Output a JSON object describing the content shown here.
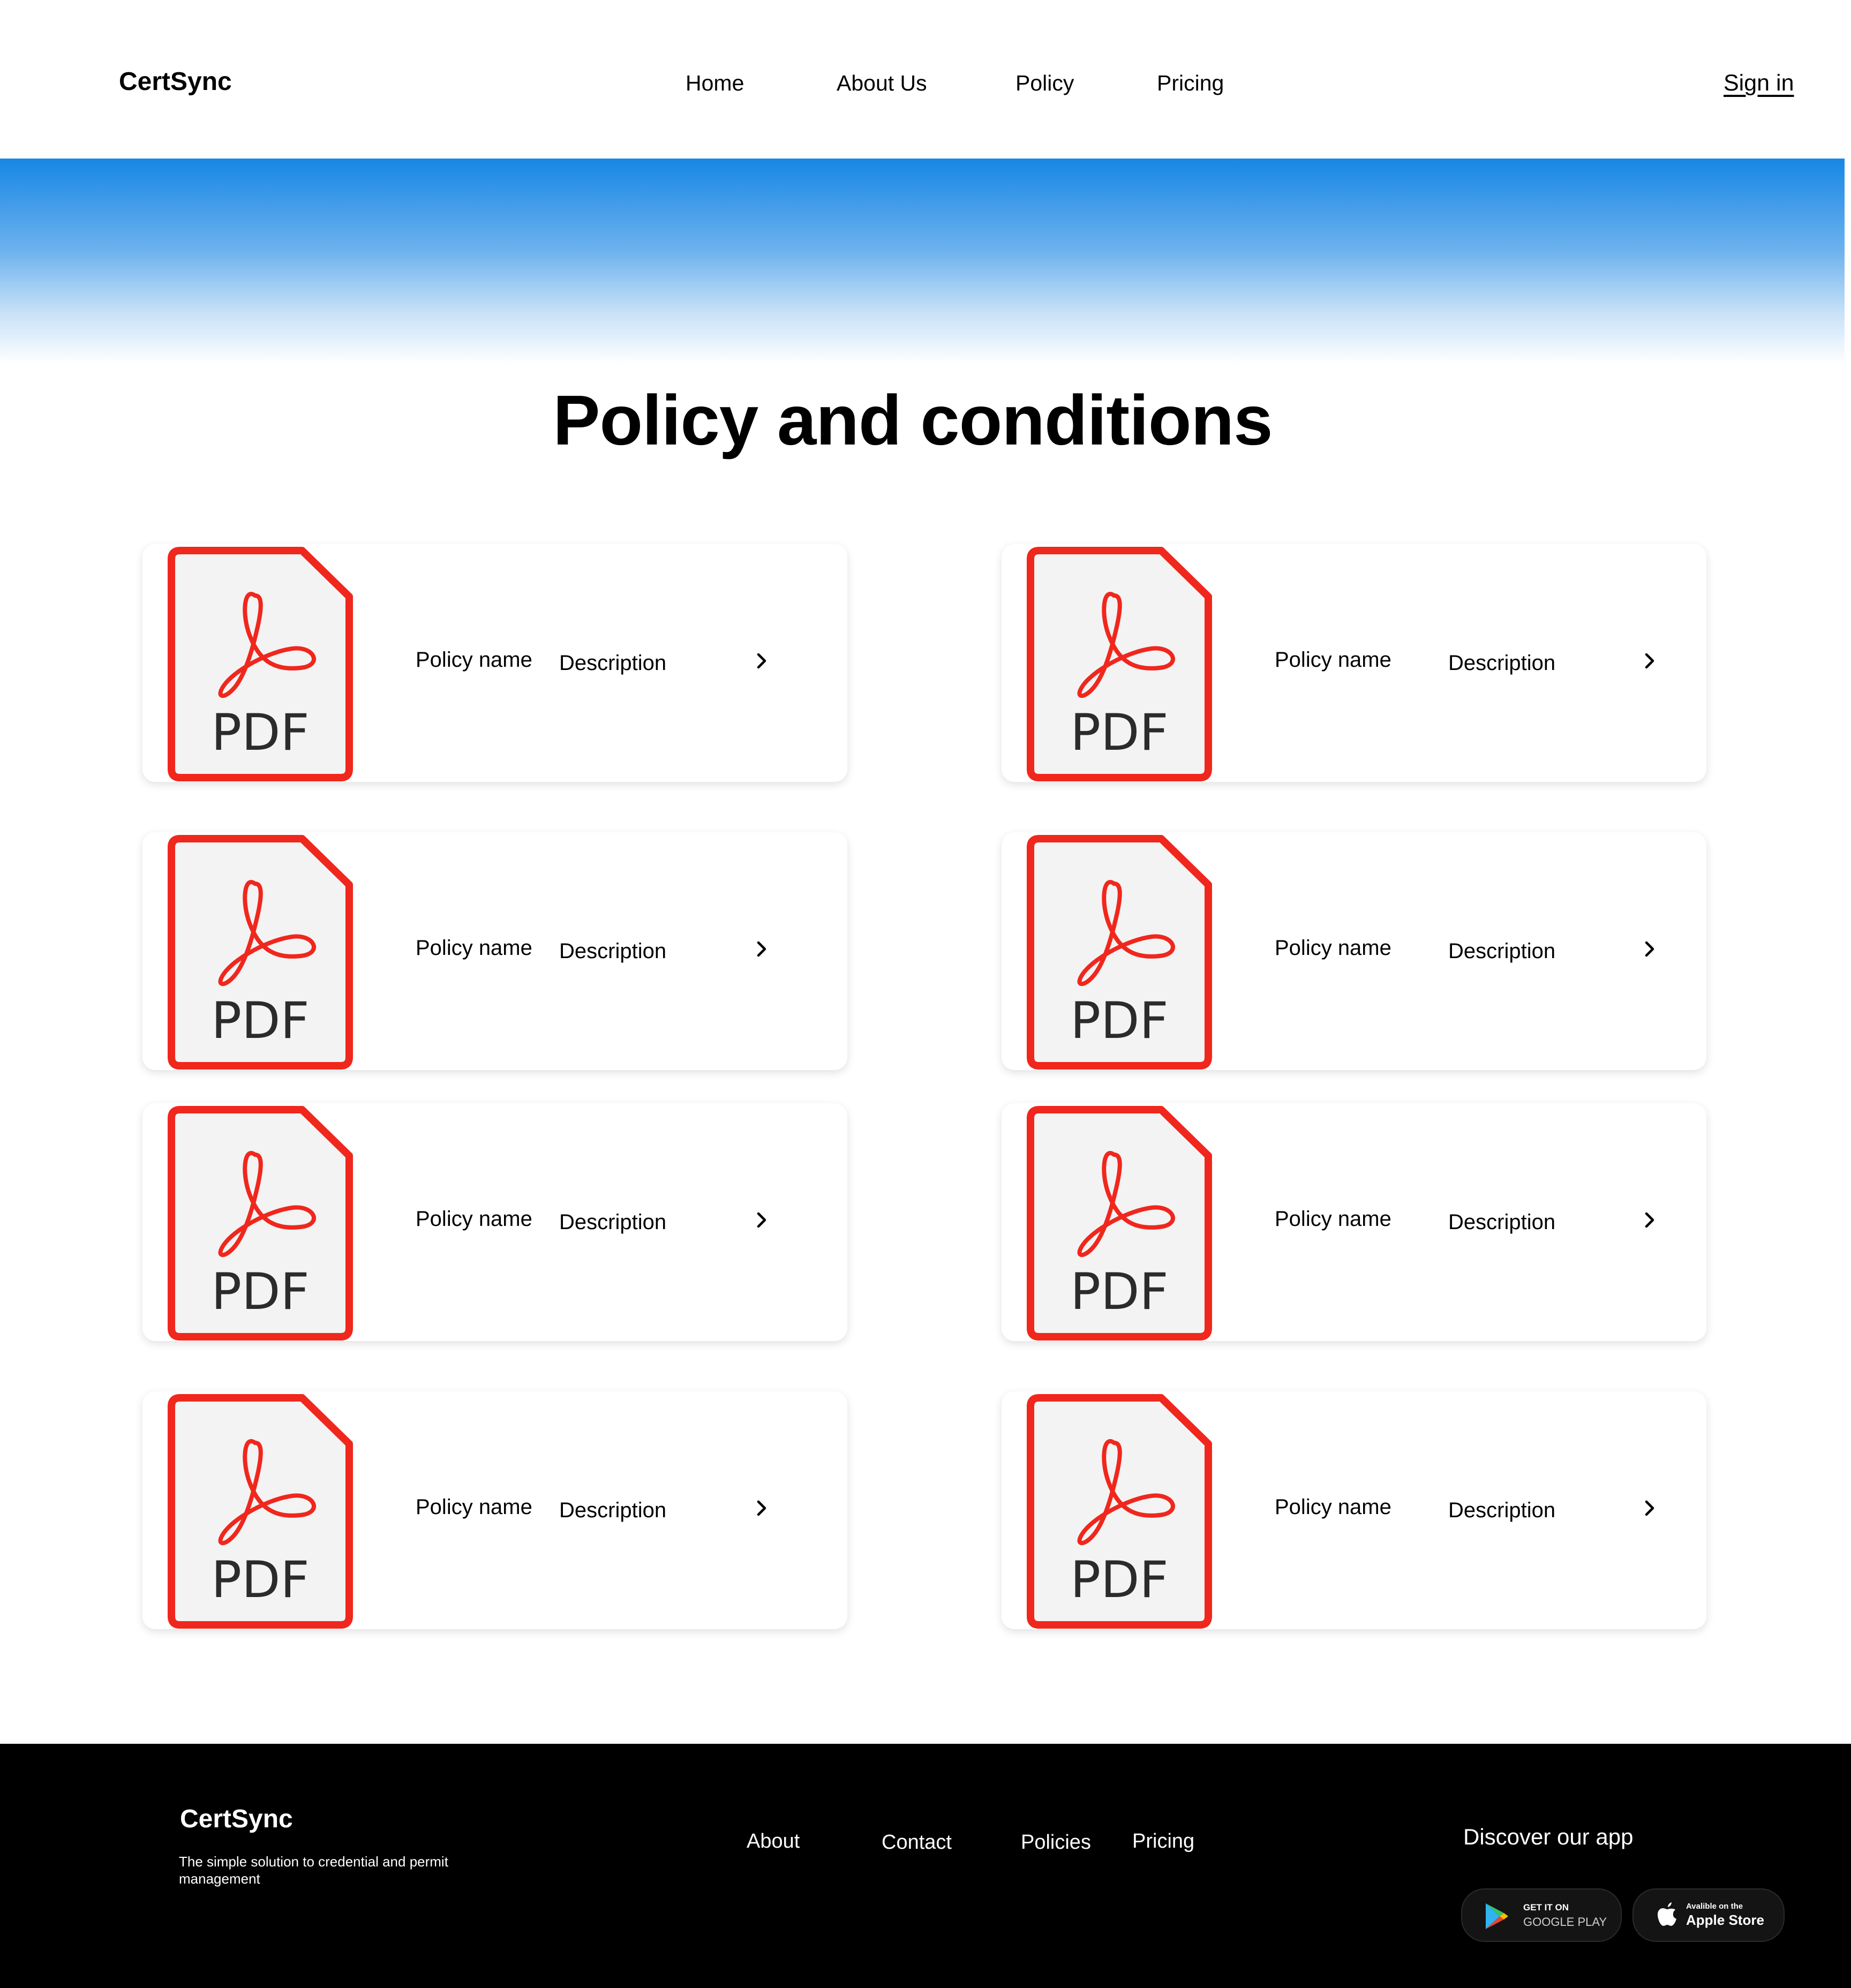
{
  "header": {
    "logo": "CertSync",
    "nav": [
      "Home",
      "About Us",
      "Policy",
      "Pricing"
    ],
    "sign_in": "Sign in"
  },
  "main": {
    "title": "Policy and conditions",
    "cards": [
      {
        "name": "Policy name",
        "description": "Description",
        "icon_label": "PDF"
      },
      {
        "name": "Policy name",
        "description": "Description",
        "icon_label": "PDF"
      },
      {
        "name": "Policy name",
        "description": "Description",
        "icon_label": "PDF"
      },
      {
        "name": "Policy name",
        "description": "Description",
        "icon_label": "PDF"
      },
      {
        "name": "Policy name",
        "description": "Description",
        "icon_label": "PDF"
      },
      {
        "name": "Policy name",
        "description": "Description",
        "icon_label": "PDF"
      },
      {
        "name": "Policy name",
        "description": "Description",
        "icon_label": "PDF"
      },
      {
        "name": "Policy name",
        "description": "Description",
        "icon_label": "PDF"
      }
    ]
  },
  "footer": {
    "logo": "CertSync",
    "tagline": "The simple solution to credential and permit management",
    "links": [
      "About",
      "Contact",
      "Policies",
      "Pricing"
    ],
    "discover": "Discover our app",
    "google_play": {
      "small": "GET IT ON",
      "big": "GOOGLE PLAY"
    },
    "apple_store": {
      "small": "Avalible on the",
      "big": "Apple Store"
    }
  },
  "colors": {
    "accent": "#1887e5",
    "pdf_red": "#f0271d",
    "pdf_fill": "#f3f3f3",
    "footer_bg": "#000000"
  },
  "icons": [
    "pdf-file-icon",
    "acrobat-logo-icon",
    "chevron-right-icon",
    "google-play-icon",
    "apple-icon"
  ]
}
